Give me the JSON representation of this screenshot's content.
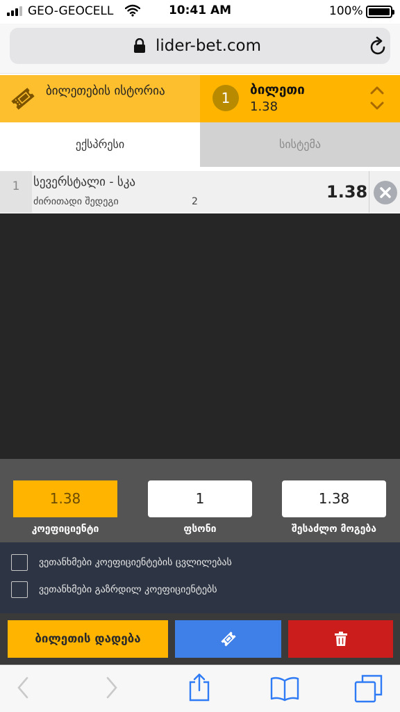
{
  "status_bar": {
    "carrier": "GEO-GEOCELL",
    "time": "10:41 AM",
    "battery": "100%"
  },
  "browser": {
    "url": "lider-bet.com"
  },
  "ticket_header": {
    "history_label": "ბილეთების ისტორია",
    "ticket_count": "1",
    "ticket_label": "ბილეთი",
    "ticket_odds": "1.38"
  },
  "tabs": [
    {
      "label": "ექსპრესი",
      "active": true
    },
    {
      "label": "სისტემა",
      "active": false
    }
  ],
  "bets": [
    {
      "index": "1",
      "match": "სევერსტალი - სკა",
      "market": "ძირითადი შედეგი",
      "outcome": "2",
      "odds": "1.38"
    }
  ],
  "stake_panel": {
    "odds_value": "1.38",
    "odds_label": "კოეფიციენტი",
    "stake_value": "1",
    "stake_label": "ფსონი",
    "win_value": "1.38",
    "win_label": "შესაძლო მოგება"
  },
  "agreements": [
    {
      "label": "ვეთანხმები კოეფიციენტების ცვლილებას",
      "checked": false
    },
    {
      "label": "ვეთანხმები გაზრდილ კოეფიციენტებს",
      "checked": false
    }
  ],
  "actions": {
    "place_label": "ბილეთის დადება",
    "save_icon": "ticket-icon",
    "clear_icon": "trash-icon"
  },
  "colors": {
    "accent": "#ffb400",
    "save": "#3f7fe8",
    "delete": "#cc1d1d",
    "dark": "#262626"
  }
}
